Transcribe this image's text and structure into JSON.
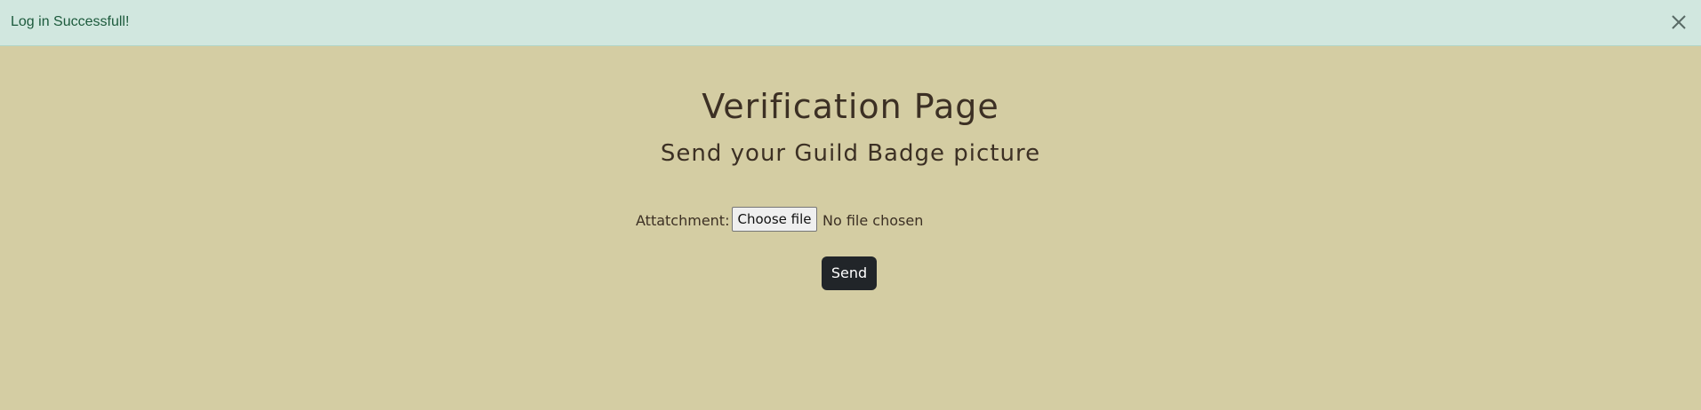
{
  "alert": {
    "message": "Log in Successfull!",
    "close_icon": "close-icon",
    "background": "#d1e7df",
    "text_color": "#1c5a3c"
  },
  "main": {
    "title": "Verification Page",
    "subtitle": "Send your Guild Badge picture",
    "form": {
      "attachment_label": "Attatchment:",
      "file_button_label": "Choose file",
      "file_status": "No file chosen",
      "submit_label": "Send"
    }
  },
  "colors": {
    "page_background": "#d4cda3",
    "heading_text": "#3c3024",
    "submit_button": "#212529"
  }
}
